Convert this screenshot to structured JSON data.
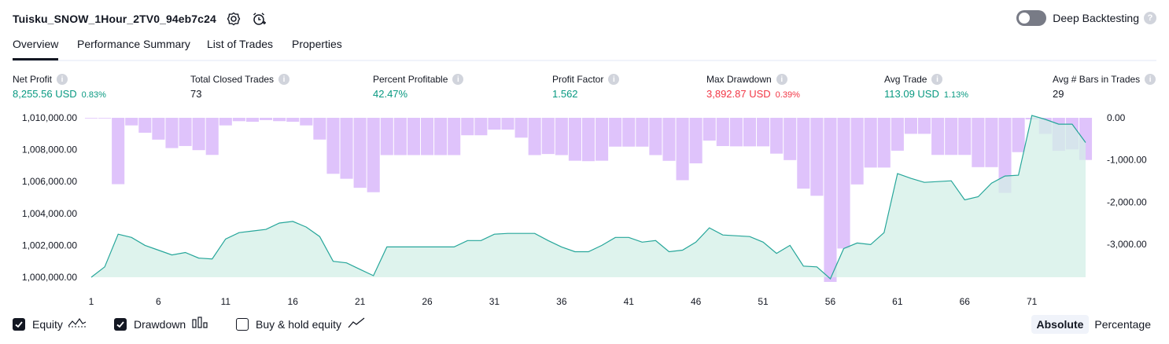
{
  "header": {
    "strategy_name": "Tuisku_SNOW_1Hour_2TV0_94eb7c24",
    "settings_icon": "gear-icon",
    "alert_icon": "alarm-clock-icon",
    "deep_backtesting_label": "Deep Backtesting",
    "deep_backtesting_on": false
  },
  "tabs": [
    {
      "label": "Overview",
      "active": true
    },
    {
      "label": "Performance Summary",
      "active": false
    },
    {
      "label": "List of Trades",
      "active": false
    },
    {
      "label": "Properties",
      "active": false
    }
  ],
  "metrics": [
    {
      "label": "Net Profit",
      "value": "8,255.56 USD",
      "pct": "0.83%",
      "color": "green"
    },
    {
      "label": "Total Closed Trades",
      "value": "73",
      "pct": "",
      "color": "dark"
    },
    {
      "label": "Percent Profitable",
      "value": "42.47%",
      "pct": "",
      "color": "green"
    },
    {
      "label": "Profit Factor",
      "value": "1.562",
      "pct": "",
      "color": "green"
    },
    {
      "label": "Max Drawdown",
      "value": "3,892.87 USD",
      "pct": "0.39%",
      "color": "red"
    },
    {
      "label": "Avg Trade",
      "value": "113.09 USD",
      "pct": "1.13%",
      "color": "green"
    },
    {
      "label": "Avg # Bars in Trades",
      "value": "29",
      "pct": "",
      "color": "dark"
    }
  ],
  "colors": {
    "equity_line": "#26a69a",
    "equity_fill": "#d3efe7",
    "drawdown_bar": "#dfc3fb",
    "green": "#089981",
    "red": "#f23645"
  },
  "chart_data": {
    "type": "area",
    "x_ticks": [
      "1",
      "6",
      "11",
      "16",
      "21",
      "26",
      "31",
      "36",
      "41",
      "46",
      "51",
      "56",
      "61",
      "66",
      "71"
    ],
    "left_axis": {
      "ticks": [
        "1,010,000.00",
        "1,008,000.00",
        "1,006,000.00",
        "1,004,000.00",
        "1,002,000.00",
        "1,000,000.00"
      ],
      "ylim": [
        1000000,
        1010000
      ]
    },
    "right_axis": {
      "ticks": [
        "0.00",
        "-1,000.00",
        "-2,000.00",
        "-3,000.00"
      ],
      "ylim": [
        -3892.87,
        0
      ]
    },
    "series": [
      {
        "name": "Equity",
        "kind": "area",
        "x": [
          1,
          2,
          3,
          4,
          5,
          6,
          7,
          8,
          9,
          10,
          11,
          12,
          13,
          14,
          15,
          16,
          17,
          18,
          19,
          20,
          21,
          22,
          23,
          24,
          25,
          26,
          27,
          28,
          29,
          30,
          31,
          32,
          33,
          34,
          35,
          36,
          37,
          38,
          39,
          40,
          41,
          42,
          43,
          44,
          45,
          46,
          47,
          48,
          49,
          50,
          51,
          52,
          53,
          54,
          55,
          56,
          57,
          58,
          59,
          60,
          61,
          62,
          63,
          64,
          65,
          66,
          67,
          68,
          69,
          70,
          71,
          72,
          73,
          74,
          75
        ],
        "values": [
          1000000,
          1000650,
          1002700,
          1002500,
          1002000,
          1001700,
          1001400,
          1001550,
          1001200,
          1001150,
          1002400,
          1002800,
          1002900,
          1003000,
          1003400,
          1003500,
          1003150,
          1002550,
          1001000,
          1000900,
          1000500,
          1000100,
          1001900,
          1001900,
          1001900,
          1001900,
          1001900,
          1001900,
          1002300,
          1002300,
          1002700,
          1002750,
          1002750,
          1002750,
          1002300,
          1001900,
          1001600,
          1001600,
          1002000,
          1002500,
          1002500,
          1002200,
          1002300,
          1001600,
          1001700,
          1002200,
          1003100,
          1002650,
          1002600,
          1002550,
          1002200,
          1001500,
          1002000,
          1000700,
          1000650,
          999900,
          1001800,
          1002150,
          1002050,
          1002800,
          1006500,
          1006200,
          1005950,
          1006000,
          1006050,
          1004850,
          1005050,
          1005900,
          1006350,
          1006400,
          1010150,
          1009900,
          1009600,
          1009600,
          1008450
        ]
      },
      {
        "name": "Drawdown",
        "kind": "bar",
        "x": [
          1,
          2,
          3,
          4,
          5,
          6,
          7,
          8,
          9,
          10,
          11,
          12,
          13,
          14,
          15,
          16,
          17,
          18,
          19,
          20,
          21,
          22,
          23,
          24,
          25,
          26,
          27,
          28,
          29,
          30,
          31,
          32,
          33,
          34,
          35,
          36,
          37,
          38,
          39,
          40,
          41,
          42,
          43,
          44,
          45,
          46,
          47,
          48,
          49,
          50,
          51,
          52,
          53,
          54,
          55,
          56,
          57,
          58,
          59,
          60,
          61,
          62,
          63,
          64,
          65,
          66,
          67,
          68,
          69,
          70,
          71,
          72,
          73,
          74,
          75
        ],
        "values": [
          0,
          0,
          -1574,
          -180,
          -354,
          -518,
          -718,
          -669,
          -767,
          -880,
          -180,
          -80,
          -94,
          -54,
          -79,
          -94,
          -180,
          -516,
          -1328,
          -1446,
          -1660,
          -1765,
          -884,
          -884,
          -884,
          -884,
          -884,
          -884,
          -414,
          -414,
          -280,
          -280,
          -471,
          -884,
          -859,
          -884,
          -1018,
          -1028,
          -1018,
          -684,
          -684,
          -684,
          -884,
          -1020,
          -1480,
          -1080,
          -540,
          -670,
          -677,
          -677,
          -677,
          -850,
          -1003,
          -1680,
          -1849,
          -3892,
          -3100,
          -1580,
          -1180,
          -1180,
          -780,
          -380,
          -380,
          -880,
          -880,
          -880,
          -1170,
          -1170,
          -1780,
          -814,
          -37,
          -381,
          -784,
          -750,
          -1000
        ]
      }
    ],
    "legend": [
      "Equity",
      "Drawdown",
      "Buy & hold equity"
    ]
  },
  "legend": {
    "equity_label": "Equity",
    "equity_checked": true,
    "drawdown_label": "Drawdown",
    "drawdown_checked": true,
    "buyhold_label": "Buy & hold equity",
    "buyhold_checked": false
  },
  "mode_switch": {
    "absolute_label": "Absolute",
    "percentage_label": "Percentage",
    "selected": "Absolute"
  }
}
